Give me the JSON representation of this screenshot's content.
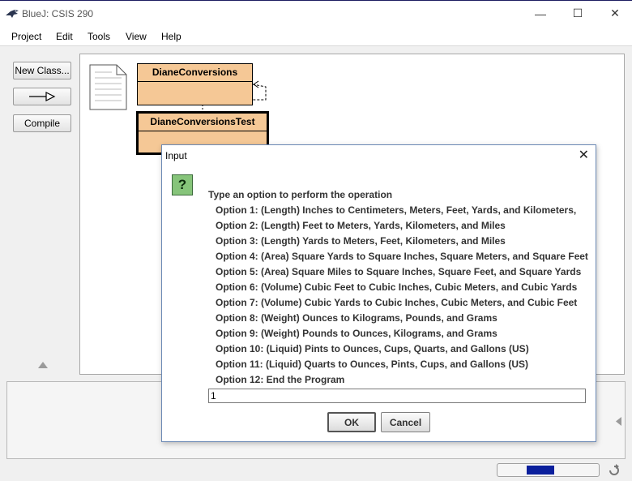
{
  "window": {
    "title": "BlueJ:  CSIS 290",
    "minimize": "—",
    "maximize": "☐",
    "close": "✕"
  },
  "menubar": {
    "items": [
      "Project",
      "Edit",
      "Tools",
      "View",
      "Help"
    ]
  },
  "sidebar": {
    "new_class_label": "New Class...",
    "arrow_label": "—▷",
    "compile_label": "Compile"
  },
  "diagram": {
    "classes": [
      {
        "name": "DianeConversions"
      },
      {
        "name": "DianeConversionsTest"
      }
    ]
  },
  "dialog": {
    "title": "Input",
    "close": "✕",
    "icon": "?",
    "prompt": "Type an option to perform the operation",
    "options": [
      "Option 1:  (Length) Inches to Centimeters, Meters, Feet, Yards, and Kilometers,",
      "Option 2:  (Length) Feet to Meters, Yards, Kilometers, and Miles",
      "Option 3:  (Length) Yards to Meters, Feet, Kilometers, and Miles",
      "Option 4:  (Area) Square Yards to Square Inches, Square Meters, and Square Feet",
      "Option 5:  (Area) Square Miles to Square Inches, Square Feet, and Square Yards",
      "Option 6:  (Volume) Cubic Feet to Cubic Inches, Cubic Meters, and Cubic Yards",
      "Option 7:  (Volume) Cubic Yards to Cubic Inches, Cubic Meters, and Cubic Feet",
      "Option 8:  (Weight) Ounces to Kilograms, Pounds, and Grams",
      "Option 9:  (Weight) Pounds to Ounces, Kilograms, and Grams",
      "Option 10: (Liquid) Pints to Ounces, Cups, Quarts, and Gallons (US)",
      "Option 11: (Liquid) Quarts to Ounces, Pints, Cups, and Gallons (US)",
      "Option 12: End the Program"
    ],
    "input_value": "1",
    "ok_label": "OK",
    "cancel_label": "Cancel"
  },
  "status": {
    "progress_fill_color": "#0a1f9c"
  },
  "colors": {
    "class_fill": "#f5c896",
    "canvas_bg": "#ffffff",
    "question_icon": "#86c47a"
  }
}
